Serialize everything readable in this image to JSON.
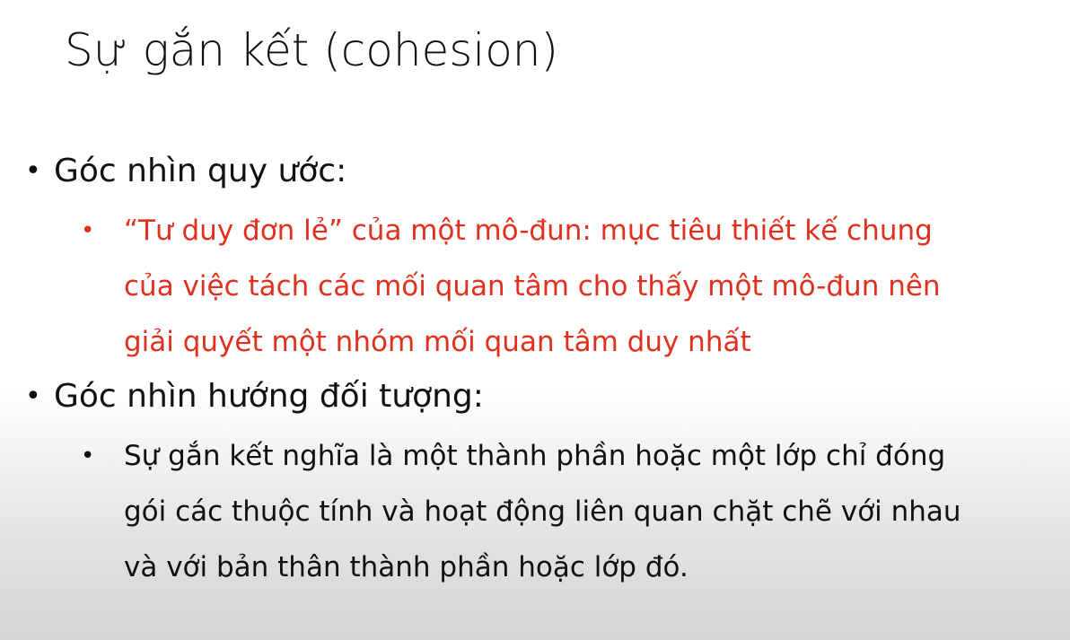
{
  "slide": {
    "title": "Sự gắn kết (cohesion)",
    "bullets": [
      {
        "label": "Góc nhìn quy ước:",
        "sub": {
          "color": "#e0301e",
          "lines": [
            "“Tư duy đơn lẻ” của một mô-đun: mục tiêu thiết kế chung",
            "của việc tách các mối quan tâm cho thấy một mô-đun nên",
            "giải quyết một nhóm mối quan tâm duy nhất"
          ]
        }
      },
      {
        "label": "Góc nhìn hướng đối tượng:",
        "sub": {
          "color": "#111111",
          "lines": [
            "Sự gắn kết nghĩa là một thành phần hoặc một lớp chỉ đóng",
            "gói các thuộc tính và hoạt động liên quan chặt chẽ với nhau",
            "và với bản thân thành phần hoặc lớp đó."
          ]
        }
      }
    ],
    "bullet_glyph": "•"
  }
}
